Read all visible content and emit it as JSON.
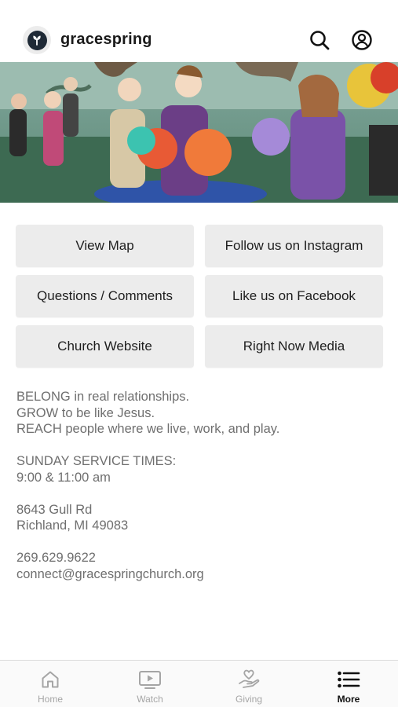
{
  "header": {
    "brand": "gracespring",
    "search_icon": "search-icon",
    "account_icon": "account-icon"
  },
  "hero": {
    "alt": "children dancing with colorful pom-poms"
  },
  "buttons": {
    "view_map": "View Map",
    "instagram": "Follow us on Instagram",
    "questions": "Questions / Comments",
    "facebook": "Like us on Facebook",
    "website": "Church Website",
    "right_now_media": "Right Now Media"
  },
  "info": {
    "mission": [
      "BELONG in real relationships.",
      "GROW to be like Jesus.",
      "REACH people where we live, work, and play."
    ],
    "service_title": "SUNDAY SERVICE TIMES:",
    "service_times": "9:00 & 11:00 am",
    "address_line1": "8643 Gull Rd",
    "address_line2": "Richland, MI 49083",
    "phone": "269.629.9622",
    "email": "connect@gracespringchurch.org"
  },
  "tabs": [
    {
      "label": "Home",
      "icon": "home-icon",
      "active": false
    },
    {
      "label": "Watch",
      "icon": "play-icon",
      "active": false
    },
    {
      "label": "Giving",
      "icon": "giving-icon",
      "active": false
    },
    {
      "label": "More",
      "icon": "list-icon",
      "active": true
    }
  ],
  "colors": {
    "button_bg": "#ececec",
    "info_text": "#6f6f6f",
    "tab_inactive": "#a5a5a5",
    "tab_active": "#111111"
  }
}
